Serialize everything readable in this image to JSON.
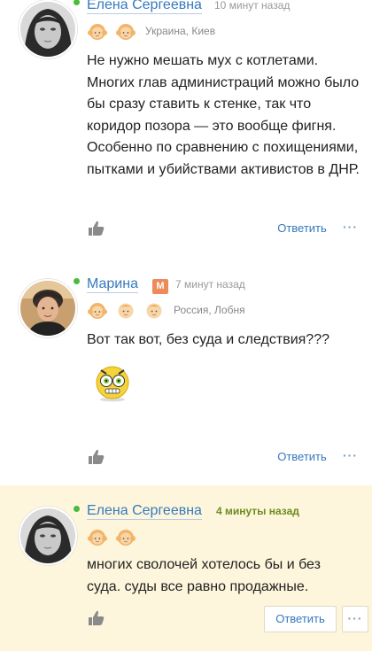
{
  "comments": [
    {
      "username": "Елена Сергеевна",
      "timestamp": "10 минут назад",
      "location": "Украина, Киев",
      "text": "Не нужно мешать мух с котлетами. Многих глав администраций можно было бы сразу ставить к стенке, так что коридор позора — это вообще фигня. Особенно по сравнению с похищениями, пытками и убийствами активистов в ДНР.",
      "reply_label": "Ответить",
      "more_label": "···"
    },
    {
      "username": "Марина",
      "badge": "М",
      "timestamp": "7 минут назад",
      "location": "Россия, Лобня",
      "text": "Вот так вот, без суда и следствия???",
      "reply_label": "Ответить",
      "more_label": "···"
    },
    {
      "username": "Елена Сергеевна",
      "timestamp": "4 минуты назад",
      "text": "многих сволочей хотелось бы и без суда. суды все равно продажные.",
      "reply_label": "Ответить",
      "more_label": "···"
    }
  ],
  "colors": {
    "link": "#3579bd",
    "online": "#4cbb3b",
    "highlight_bg": "#fdf6dc",
    "new_timestamp": "#6d8b1c",
    "badge": "#ee8a5a"
  }
}
